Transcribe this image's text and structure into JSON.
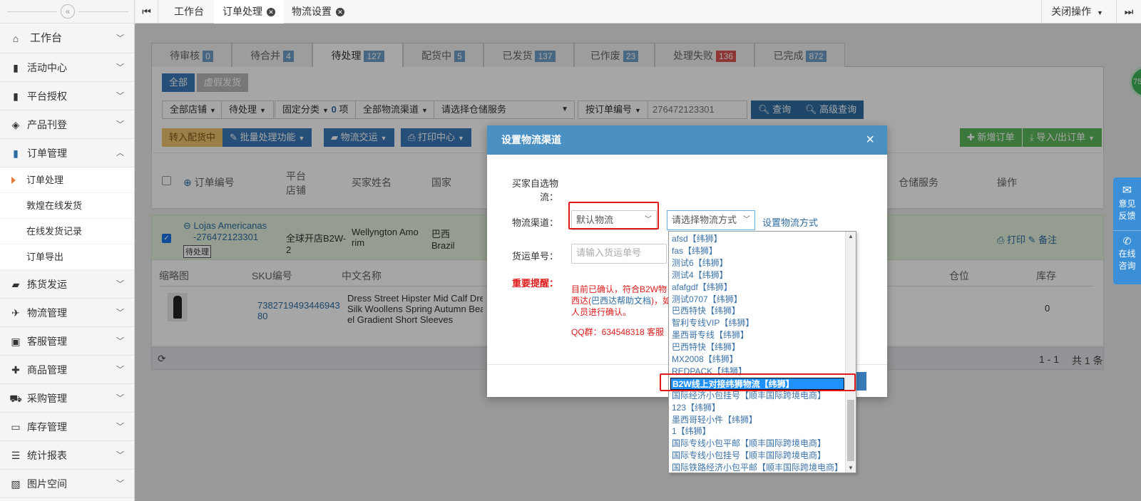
{
  "sidebar": {
    "items": [
      {
        "label": "工作台",
        "icon": "home-icon"
      },
      {
        "label": "活动中心",
        "icon": "file-icon"
      },
      {
        "label": "平台授权",
        "icon": "bookmark-icon"
      },
      {
        "label": "产品刊登",
        "icon": "box-icon"
      },
      {
        "label": "订单管理",
        "icon": "document-icon"
      },
      {
        "label": "拣货发运",
        "icon": "truck-icon"
      },
      {
        "label": "物流管理",
        "icon": "plane-icon"
      },
      {
        "label": "客服管理",
        "icon": "briefcase-icon"
      },
      {
        "label": "商品管理",
        "icon": "gift-icon"
      },
      {
        "label": "采购管理",
        "icon": "cart-icon"
      },
      {
        "label": "库存管理",
        "icon": "inbox-icon"
      },
      {
        "label": "统计报表",
        "icon": "list-icon"
      },
      {
        "label": "图片空间",
        "icon": "image-icon"
      }
    ],
    "subitems": [
      "订单处理",
      "敦煌在线发货",
      "在线发货记录",
      "订单导出"
    ]
  },
  "topbar": {
    "tabs": [
      "工作台",
      "订单处理",
      "物流设置"
    ],
    "close_ops": "关闭操作"
  },
  "status_tabs": [
    {
      "label": "待审核",
      "count": "0"
    },
    {
      "label": "待合并",
      "count": "4"
    },
    {
      "label": "待处理",
      "count": "127"
    },
    {
      "label": "配货中",
      "count": "5"
    },
    {
      "label": "已发货",
      "count": "137"
    },
    {
      "label": "已作废",
      "count": "23"
    },
    {
      "label": "处理失败",
      "count": "136"
    },
    {
      "label": "已完成",
      "count": "872"
    }
  ],
  "filters": {
    "all": "全部",
    "virtual": "虚假发货",
    "all_stores": "全部店铺",
    "pending": "待处理",
    "fixed_cat": "固定分类",
    "fixed_count": "0",
    "fixed_unit": "项",
    "all_channels": "全部物流渠道",
    "warehouse": "请选择仓储服务",
    "by_order": "按订单编号",
    "order_value": "276472123301",
    "search": "查询",
    "advanced": "高级查询"
  },
  "actions": {
    "to_picking": "转入配货中",
    "batch": "批量处理功能",
    "handover": "物流交运",
    "print": "打印中心",
    "new_order": "新增订单",
    "import_export": "导入/出订单"
  },
  "table": {
    "order_no": "订单编号",
    "platform_l1": "平台",
    "platform_l2": "店铺",
    "buyer": "买家姓名",
    "country": "国家",
    "warehouse_svc": "仓储服务",
    "ops": "操作"
  },
  "order": {
    "store": "Lojas Americanas",
    "order_id": "-276472123301",
    "status": "待处理",
    "shop_l1": "全球开店B2W-",
    "shop_l2": "2",
    "buyer_l1": "Wellyngton Amo",
    "buyer_l2": "rim",
    "country_cn": "巴西",
    "country_en": "Brazil",
    "print": "打印",
    "note": "备注"
  },
  "items_head": {
    "thumb": "缩略图",
    "sku": "SKU编号",
    "name": "中文名称",
    "location": "仓位",
    "stock": "库存"
  },
  "item": {
    "sku_l1": "7382719493446943",
    "sku_l2": "80",
    "name_l1": "Dress Street Hipster Mid Calf Dres",
    "name_l2": "Silk Woollens Spring Autumn Beac",
    "name_l3": "el Gradient Short Sleeves",
    "stock": "0"
  },
  "pager": {
    "range": "1 - 1",
    "total": "共 1 条"
  },
  "modal": {
    "title": "设置物流渠道",
    "close": "×",
    "buyer_choice_l1": "买家自选物",
    "buyer_choice_l2": "流：",
    "channel_label": "物流渠道：",
    "channel_value": "默认物流",
    "method_placeholder": "请选择物流方式",
    "set_method": "设置物流方式",
    "tracking_label": "货运单号：",
    "tracking_placeholder": "请输入货运单号",
    "notice_label": "重要提醒：",
    "notice_l1": "目前已确认，符合B2W物",
    "notice_l2a": "西达(",
    "notice_link": "巴西达帮助文档",
    "notice_l2b": ")，如",
    "notice_l3": "人员进行确认。",
    "qq": "QQ群：634548318 客服"
  },
  "dropdown": {
    "options": [
      "afsd【纬狮】",
      "fas【纬狮】",
      "测试6【纬狮】",
      "测试4【纬狮】",
      "afafgdf【纬狮】",
      "测试0707【纬狮】",
      "巴西特快【纬狮】",
      "智利专线VIP【纬狮】",
      "墨西哥专线【纬狮】",
      "巴西特快【纬狮】",
      "MX2008【纬狮】",
      "REDPACK【纬狮】",
      "B2W线上对接纬狮物流【纬狮】",
      "国际经济小包挂号【顺丰国际跨境电商】",
      "123【纬狮】",
      "墨西哥轻小件【纬狮】",
      "1【纬狮】",
      "国际专线小包平邮【顺丰国际跨境电商】",
      "国际专线小包挂号【顺丰国际跨境电商】",
      "国际铁路经济小包平邮【顺丰国际跨境电商】"
    ],
    "selected_index": 12
  },
  "right_float": {
    "feedback_l1": "意见",
    "feedback_l2": "反馈",
    "consult_l1": "在线",
    "consult_l2": "咨询"
  },
  "bubble": "75"
}
